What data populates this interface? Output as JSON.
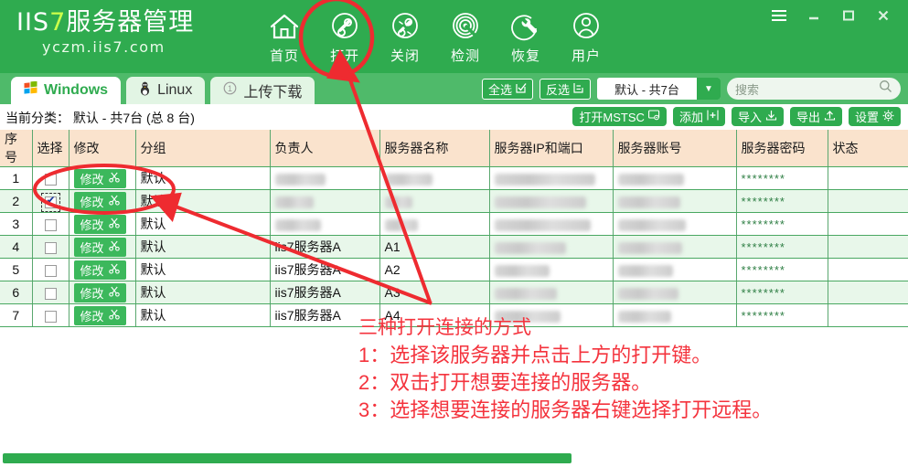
{
  "app": {
    "logo_prefix": "IIS",
    "logo_seven": "7",
    "logo_rest": "服务器管理",
    "logo_sub": "yczm.iis7.com"
  },
  "toolbar": {
    "items": [
      {
        "label": "首页",
        "icon": "home-icon"
      },
      {
        "label": "打开",
        "icon": "link-icon"
      },
      {
        "label": "关闭",
        "icon": "broken-link-icon"
      },
      {
        "label": "检测",
        "icon": "radar-icon"
      },
      {
        "label": "恢复",
        "icon": "wrench-icon"
      },
      {
        "label": "用户",
        "icon": "user-icon"
      }
    ]
  },
  "window_controls": {
    "menu": "☰",
    "minimize": "_",
    "maximize": "❐",
    "close": "✕"
  },
  "tabs": [
    {
      "label": "Windows",
      "icon": "windows-logo-icon",
      "active": true
    },
    {
      "label": "Linux",
      "icon": "tux-penguin-icon",
      "active": false
    },
    {
      "label": "上传下载",
      "icon": "circle-one-icon",
      "active": false
    }
  ],
  "tabbar_tools": {
    "select_all": "全选",
    "invert_select": "反选",
    "group_select_value": "默认 - 共7台",
    "search_placeholder": "搜索"
  },
  "subheader": {
    "current_category": "当前分类： 默认 - 共7台 (总 8 台)",
    "actions": [
      {
        "label": "打开MSTSC",
        "icon": "monitor-icon"
      },
      {
        "label": "添加",
        "icon": "plus-box-icon"
      },
      {
        "label": "导入",
        "icon": "download-arrow-icon"
      },
      {
        "label": "导出",
        "icon": "upload-arrow-icon"
      },
      {
        "label": "设置",
        "icon": "gear-icon"
      }
    ]
  },
  "table": {
    "columns": [
      "序号",
      "选择",
      "修改",
      "分组",
      "负责人",
      "服务器名称",
      "服务器IP和端口",
      "服务器账号",
      "服务器密码",
      "状态"
    ],
    "edit_label": "修改",
    "password_mask": "********",
    "rows": [
      {
        "idx": "1",
        "checked": false,
        "group": "默认",
        "owner": "",
        "owner_blur": 55,
        "name": "",
        "name_blur": 52,
        "ip": "",
        "ip_blur": 110,
        "account": "",
        "account_blur": 72,
        "password": "********",
        "status": ""
      },
      {
        "idx": "2",
        "checked": true,
        "group": "默认",
        "owner": "",
        "owner_blur": 42,
        "name": "",
        "name_blur": 30,
        "ip": "",
        "ip_blur": 100,
        "account": "",
        "account_blur": 68,
        "password": "********",
        "status": ""
      },
      {
        "idx": "3",
        "checked": false,
        "group": "默认",
        "owner": "",
        "owner_blur": 50,
        "name": "",
        "name_blur": 36,
        "ip": "",
        "ip_blur": 105,
        "account": "",
        "account_blur": 74,
        "password": "********",
        "status": ""
      },
      {
        "idx": "4",
        "checked": false,
        "group": "默认",
        "owner": "iis7服务器A",
        "owner_blur": 0,
        "name": "A1",
        "name_blur": 0,
        "ip": "",
        "ip_blur": 78,
        "account": "",
        "account_blur": 70,
        "password": "********",
        "status": ""
      },
      {
        "idx": "5",
        "checked": false,
        "group": "默认",
        "owner": "iis7服务器A",
        "owner_blur": 0,
        "name": "A2",
        "name_blur": 0,
        "ip": "",
        "ip_blur": 60,
        "account": "",
        "account_blur": 60,
        "password": "********",
        "status": ""
      },
      {
        "idx": "6",
        "checked": false,
        "group": "默认",
        "owner": "iis7服务器A",
        "owner_blur": 0,
        "name": "A3",
        "name_blur": 0,
        "ip": "",
        "ip_blur": 68,
        "account": "",
        "account_blur": 66,
        "password": "********",
        "status": ""
      },
      {
        "idx": "7",
        "checked": false,
        "group": "默认",
        "owner": "iis7服务器A",
        "owner_blur": 0,
        "name": "A4",
        "name_blur": 0,
        "ip": "",
        "ip_blur": 72,
        "account": "",
        "account_blur": 58,
        "password": "********",
        "status": ""
      }
    ]
  },
  "annotation": {
    "title": "三种打开连接的方式",
    "line1": "1：选择该服务器并点击上方的打开键。",
    "line2": "2：双击打开想要连接的服务器。",
    "line3": "3：选择想要连接的服务器右键选择打开远程。"
  },
  "colors": {
    "brand_green": "#2fab4f",
    "tab_green": "#4fba6a",
    "header_peach": "#fae3cd",
    "row_alt_green": "#e8f7ea",
    "annotation_red": "#f4333d",
    "logo_accent": "#cdff4a"
  }
}
